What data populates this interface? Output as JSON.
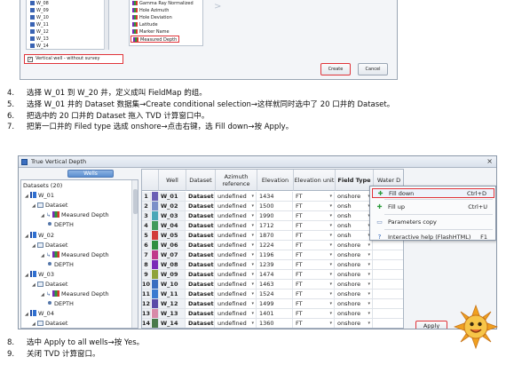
{
  "top_dialog": {
    "wells": [
      "W_08",
      "W_09",
      "W_10",
      "W_11",
      "W_12",
      "W_13",
      "W_14"
    ],
    "logs": [
      "Gamma Ray Normalized",
      "Hole Azimuth",
      "Hole Deviation",
      "Latitude",
      "Marker Name",
      "Measured Depth"
    ],
    "vertical_checkbox_label": "Vertical well - without survey",
    "create_label": "Create",
    "cancel_label": "Cancel"
  },
  "steps1": [
    {
      "num": "4.",
      "text": "选择 W_01 到 W_20 井，定义成叫 FieldMap 的组。"
    },
    {
      "num": "5.",
      "text": "选择 W_01 井的 Dataset 数据集→Create conditional selection→这样就同时选中了 20 口井的 Dataset。"
    },
    {
      "num": "6.",
      "text": "把选中的 20 口井的 Dataset 拖入 TVD 计算窗口中。"
    },
    {
      "num": "7.",
      "text": "把第一口井的 Filed type 选成 onshore→点击右键，选 Fill down→按 Apply。"
    }
  ],
  "tvd": {
    "title": "True Vertical Depth",
    "wells_tab": "Wells",
    "tree": [
      {
        "label": "Datasets (20)",
        "kind": "root"
      },
      {
        "label": "W_01",
        "kind": "well"
      },
      {
        "label": "Dataset",
        "kind": "ds"
      },
      {
        "label": "Measured Depth",
        "kind": "md"
      },
      {
        "label": "DEPTH",
        "kind": "depth"
      },
      {
        "label": "W_02",
        "kind": "well"
      },
      {
        "label": "Dataset",
        "kind": "ds"
      },
      {
        "label": "Measured Depth",
        "kind": "md"
      },
      {
        "label": "DEPTH",
        "kind": "depth"
      },
      {
        "label": "W_03",
        "kind": "well"
      },
      {
        "label": "Dataset",
        "kind": "ds"
      },
      {
        "label": "Measured Depth",
        "kind": "md"
      },
      {
        "label": "DEPTH",
        "kind": "depth"
      },
      {
        "label": "W_04",
        "kind": "well"
      },
      {
        "label": "Dataset",
        "kind": "ds"
      }
    ],
    "columns": {
      "well": "Well",
      "dataset": "Dataset",
      "azimuth": "Azimuth reference",
      "elevation": "Elevation",
      "unit": "Elevation unit",
      "field_type": "Field Type",
      "water_depth": "Water D"
    },
    "rows": [
      {
        "n": "1",
        "well": "W_01",
        "ds": "Dataset",
        "azi": "undefined",
        "elv": "1434",
        "unit": "FT",
        "ft": "onshore",
        "color": "#6b5fb5"
      },
      {
        "n": "2",
        "well": "W_02",
        "ds": "Dataset",
        "azi": "undefined",
        "elv": "1500",
        "unit": "FT",
        "ft": "onsh",
        "color": "#7b8fc8"
      },
      {
        "n": "3",
        "well": "W_03",
        "ds": "Dataset",
        "azi": "undefined",
        "elv": "1990",
        "unit": "FT",
        "ft": "onsh",
        "color": "#4aa7b8"
      },
      {
        "n": "4",
        "well": "W_04",
        "ds": "Dataset",
        "azi": "undefined",
        "elv": "1712",
        "unit": "FT",
        "ft": "onsh",
        "color": "#3f9a5a"
      },
      {
        "n": "5",
        "well": "W_05",
        "ds": "Dataset",
        "azi": "undefined",
        "elv": "1870",
        "unit": "FT",
        "ft": "onsh",
        "color": "#d23a3a"
      },
      {
        "n": "6",
        "well": "W_06",
        "ds": "Dataset",
        "azi": "undefined",
        "elv": "1224",
        "unit": "FT",
        "ft": "onshore",
        "color": "#2f8f3f"
      },
      {
        "n": "7",
        "well": "W_07",
        "ds": "Dataset",
        "azi": "undefined",
        "elv": "1196",
        "unit": "FT",
        "ft": "onshore",
        "color": "#c0398a"
      },
      {
        "n": "8",
        "well": "W_08",
        "ds": "Dataset",
        "azi": "undefined",
        "elv": "1239",
        "unit": "FT",
        "ft": "onshore",
        "color": "#7a2ab8"
      },
      {
        "n": "9",
        "well": "W_09",
        "ds": "Dataset",
        "azi": "undefined",
        "elv": "1474",
        "unit": "FT",
        "ft": "onshore",
        "color": "#8fa23a"
      },
      {
        "n": "10",
        "well": "W_10",
        "ds": "Dataset",
        "azi": "undefined",
        "elv": "1463",
        "unit": "FT",
        "ft": "onshore",
        "color": "#3a6ec0"
      },
      {
        "n": "11",
        "well": "W_11",
        "ds": "Dataset",
        "azi": "undefined",
        "elv": "1524",
        "unit": "FT",
        "ft": "onshore",
        "color": "#3a7ad0"
      },
      {
        "n": "12",
        "well": "W_12",
        "ds": "Dataset",
        "azi": "undefined",
        "elv": "1499",
        "unit": "FT",
        "ft": "onshore",
        "color": "#5a4aa8"
      },
      {
        "n": "13",
        "well": "W_13",
        "ds": "Dataset",
        "azi": "undefined",
        "elv": "1401",
        "unit": "FT",
        "ft": "onshore",
        "color": "#d88aa8"
      },
      {
        "n": "14",
        "well": "W_14",
        "ds": "Dataset",
        "azi": "undefined",
        "elv": "1360",
        "unit": "FT",
        "ft": "onshore",
        "color": "#4a7a4a"
      }
    ],
    "context_menu": [
      {
        "label": "Fill down",
        "key": "Ctrl+D",
        "icon": "fill-down-icon",
        "highlight": true
      },
      {
        "label": "Fill up",
        "key": "Ctrl+U",
        "icon": "fill-up-icon",
        "highlight": false
      },
      {
        "label": "Parameters copy",
        "key": "",
        "icon": "copy-icon",
        "highlight": false
      },
      {
        "label": "Interactive help (FlashHTML)",
        "key": "F1",
        "icon": "help-icon",
        "highlight": false
      }
    ],
    "apply_label": "Apply"
  },
  "steps2": [
    {
      "num": "8.",
      "text": "选中 Apply to all wells→按 Yes。"
    },
    {
      "num": "9.",
      "text": "关闭 TVD 计算窗口。"
    }
  ],
  "colors": {
    "highlight_red": "#e0343a",
    "accent_blue": "#5b8fd0"
  }
}
